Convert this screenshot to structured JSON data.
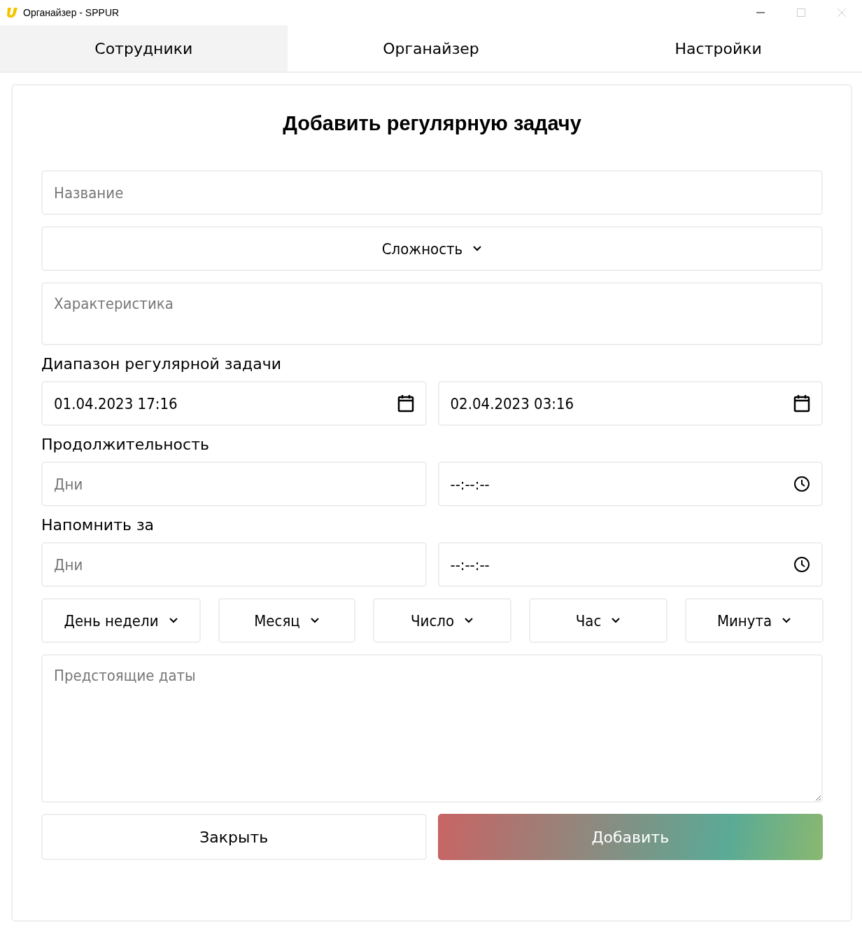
{
  "window": {
    "title": "Органайзер - SPPUR"
  },
  "tabs": [
    {
      "label": "Сотрудники",
      "selected": true
    },
    {
      "label": "Органайзер",
      "selected": false
    },
    {
      "label": "Настройки",
      "selected": false
    }
  ],
  "form": {
    "title": "Добавить регулярную задачу",
    "name_field": {
      "placeholder": "Название"
    },
    "difficulty": {
      "label": "Сложность"
    },
    "description": {
      "placeholder": "Характеристика"
    },
    "range_label": "Диапазон регулярной задачи",
    "range_start": {
      "value": "01.04.2023 17:16"
    },
    "range_end": {
      "value": "02.04.2023 03:16"
    },
    "duration_label": "Продолжительность",
    "duration_days": {
      "placeholder": "Дни"
    },
    "duration_time": {
      "placeholder": "--:--:--"
    },
    "remind_label": "Напомнить за",
    "remind_days": {
      "placeholder": "Дни"
    },
    "remind_time": {
      "placeholder": "--:--:--"
    },
    "selects": [
      {
        "label": "День недели"
      },
      {
        "label": "Месяц"
      },
      {
        "label": "Число"
      },
      {
        "label": "Час"
      },
      {
        "label": "Минута"
      }
    ],
    "upcoming": {
      "placeholder": "Предстоящие даты"
    },
    "buttons": [
      {
        "label": "Закрыть",
        "kind": "secondary"
      },
      {
        "label": "Добавить",
        "kind": "primary"
      }
    ]
  }
}
